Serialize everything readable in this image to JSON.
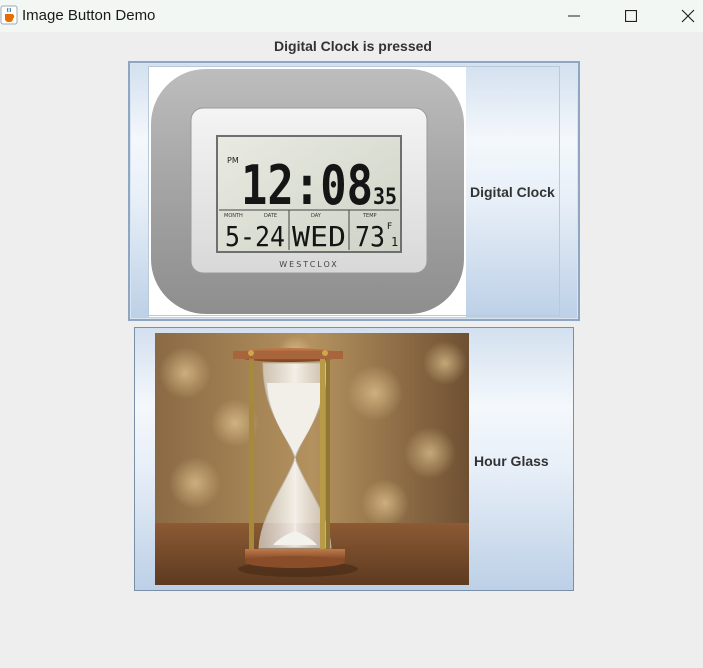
{
  "window": {
    "title": "Image Button Demo",
    "icon": "java-cup-icon",
    "controls": [
      "minimize-icon",
      "maximize-icon",
      "close-icon"
    ]
  },
  "status": "Digital Clock is pressed",
  "buttons": [
    {
      "label": "Digital Clock",
      "image": "digital-clock",
      "clock_face": {
        "period": "PM",
        "time": "12:08",
        "seconds": "35",
        "date": "5-24",
        "day": "WED",
        "temp": "73",
        "temp_unit": "F",
        "temp_decimal": "1",
        "caption_month": "MONTH",
        "caption_date": "DATE",
        "caption_day": "DAY",
        "caption_temp": "TEMP",
        "brand": "WESTCLOX"
      }
    },
    {
      "label": "Hour Glass",
      "image": "hourglass"
    }
  ],
  "colors": {
    "window_bg": "#eeeeee",
    "titlebar_bg": "#f3f7f3",
    "button_gradient_top": "#d3e0ef",
    "button_gradient_bottom": "#bcd0e6",
    "button_border": "#7a8ea8",
    "label_text": "#333333"
  }
}
